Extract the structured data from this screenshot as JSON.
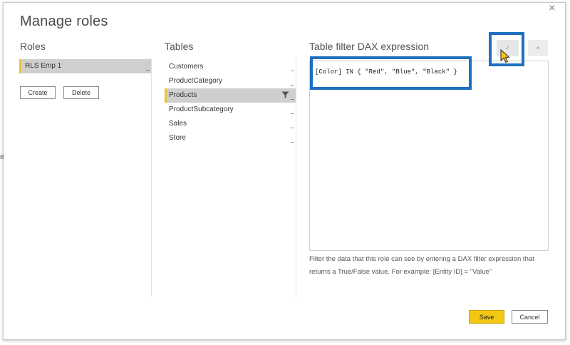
{
  "dialog": {
    "title": "Manage roles",
    "close_glyph": "×",
    "stray_mark": "e"
  },
  "roles": {
    "heading": "Roles",
    "items": [
      {
        "label": "RLS Emp 1",
        "more": "..."
      }
    ],
    "create_label": "Create",
    "delete_label": "Delete"
  },
  "tables": {
    "heading": "Tables",
    "items": [
      {
        "label": "Customers",
        "more": "..."
      },
      {
        "label": "ProductCategory",
        "more": "..."
      },
      {
        "label": "Products",
        "more": "...",
        "selected": true,
        "icon": "filter-icon"
      },
      {
        "label": "ProductSubcategory",
        "more": "..."
      },
      {
        "label": "Sales",
        "more": "..."
      },
      {
        "label": "Store",
        "more": "..."
      }
    ]
  },
  "dax": {
    "heading": "Table filter DAX expression",
    "check_glyph": "✓",
    "cancel_glyph": "×",
    "expression": "[Color] IN { \"Red\", \"Blue\", \"Black\" }",
    "help": "Filter the data that this role can see by entering a DAX filter expression that returns a True/False value. For example: [Entity ID] = \"Value\""
  },
  "footer": {
    "save_label": "Save",
    "cancel_label": "Cancel"
  },
  "colors": {
    "accent": "#f2c811",
    "selection": "#cfcfcf",
    "annotation": "#1f6fbf"
  }
}
